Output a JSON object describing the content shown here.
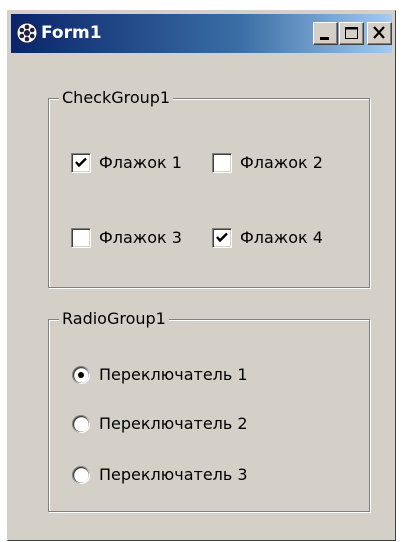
{
  "window": {
    "title": "Form1",
    "app_icon": "gear-app-icon",
    "controls": [
      "minimize-icon",
      "maximize-icon",
      "close-icon"
    ]
  },
  "check_group": {
    "caption": "CheckGroup1",
    "items": [
      {
        "label": "Флажок 1",
        "checked": true
      },
      {
        "label": "Флажок 2",
        "checked": false
      },
      {
        "label": "Флажок 3",
        "checked": false
      },
      {
        "label": "Флажок 4",
        "checked": true
      }
    ]
  },
  "radio_group": {
    "caption": "RadioGroup1",
    "selected_index": 0,
    "items": [
      {
        "label": "Переключатель 1"
      },
      {
        "label": "Переключатель 2"
      },
      {
        "label": "Переключатель 3"
      }
    ]
  },
  "colors": {
    "face": "#d4d0c8",
    "title_start": "#0a246a",
    "title_end": "#a6caf0"
  }
}
